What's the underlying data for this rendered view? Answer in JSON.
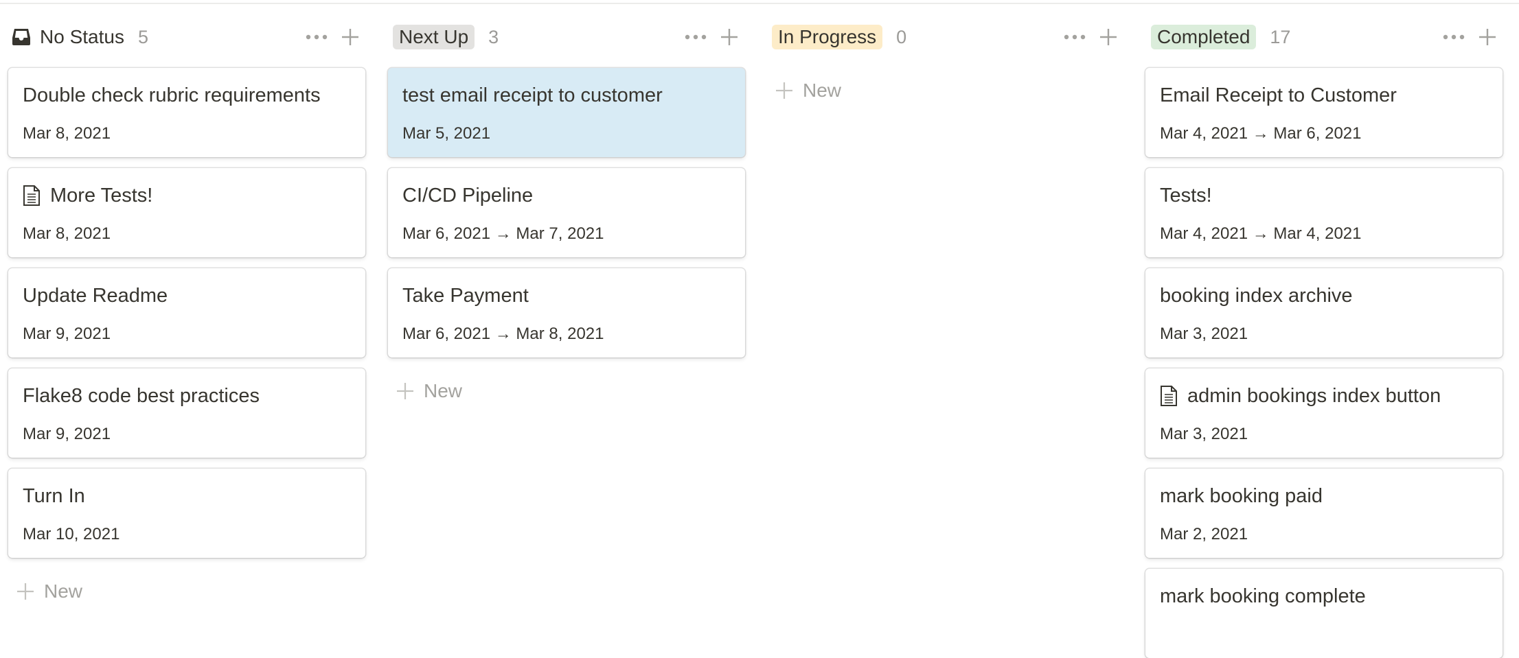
{
  "colors": {
    "next_up_pill": "#e3e2e0",
    "in_progress_pill": "#fdecc8",
    "completed_pill": "#dbeddb",
    "selected_card": "#d8ebf5",
    "muted_text": "#9b9a97"
  },
  "board": {
    "new_label": "New",
    "columns": [
      {
        "title": "No Status",
        "count": "5",
        "icon": "inbox-icon",
        "cards": [
          {
            "title": "Double check rubric requirements",
            "date": "Mar 8, 2021"
          },
          {
            "title": "More Tests!",
            "date": "Mar 8, 2021",
            "icon": "document-icon"
          },
          {
            "title": "Update Readme",
            "date": "Mar 9, 2021"
          },
          {
            "title": "Flake8 code best practices",
            "date": "Mar 9, 2021"
          },
          {
            "title": "Turn In",
            "date": "Mar 10, 2021"
          }
        ]
      },
      {
        "title": "Next Up",
        "count": "3",
        "cards": [
          {
            "title": "test email receipt to customer",
            "date": "Mar 5, 2021",
            "selected": true
          },
          {
            "title": "CI/CD Pipeline",
            "date": "Mar 6, 2021 → Mar 7, 2021"
          },
          {
            "title": "Take Payment",
            "date": "Mar 6, 2021 → Mar 8, 2021"
          }
        ]
      },
      {
        "title": "In Progress",
        "count": "0",
        "cards": []
      },
      {
        "title": "Completed",
        "count": "17",
        "cards": [
          {
            "title": "Email Receipt to Customer",
            "date": "Mar 4, 2021 → Mar 6, 2021"
          },
          {
            "title": "Tests!",
            "date": "Mar 4, 2021 → Mar 4, 2021"
          },
          {
            "title": "booking index archive",
            "date": "Mar 3, 2021"
          },
          {
            "title": "admin bookings index button",
            "date": "Mar 3, 2021",
            "icon": "document-icon"
          },
          {
            "title": "mark booking paid",
            "date": "Mar 2, 2021"
          },
          {
            "title": "mark booking complete",
            "date": ""
          }
        ]
      }
    ]
  }
}
